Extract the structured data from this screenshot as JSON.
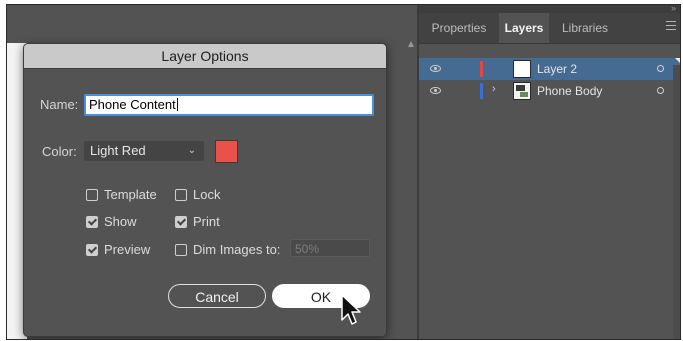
{
  "dialog": {
    "title": "Layer Options",
    "name_label": "Name:",
    "name_value": "Phone Content",
    "color_label": "Color:",
    "color_value": "Light Red",
    "swatch_color": "#e8524a",
    "options": {
      "template": "Template",
      "lock": "Lock",
      "show": "Show",
      "print": "Print",
      "preview": "Preview",
      "dim_images": "Dim Images to:"
    },
    "dim_value": "50%",
    "cancel_label": "Cancel",
    "ok_label": "OK"
  },
  "panel": {
    "tabs": [
      "Properties",
      "Layers",
      "Libraries"
    ],
    "active_tab": "Layers",
    "layers": [
      {
        "name": "Layer 2",
        "color": "#e04848",
        "selected": true
      },
      {
        "name": "Phone Body",
        "color": "#3b6fd4",
        "selected": false
      }
    ]
  }
}
